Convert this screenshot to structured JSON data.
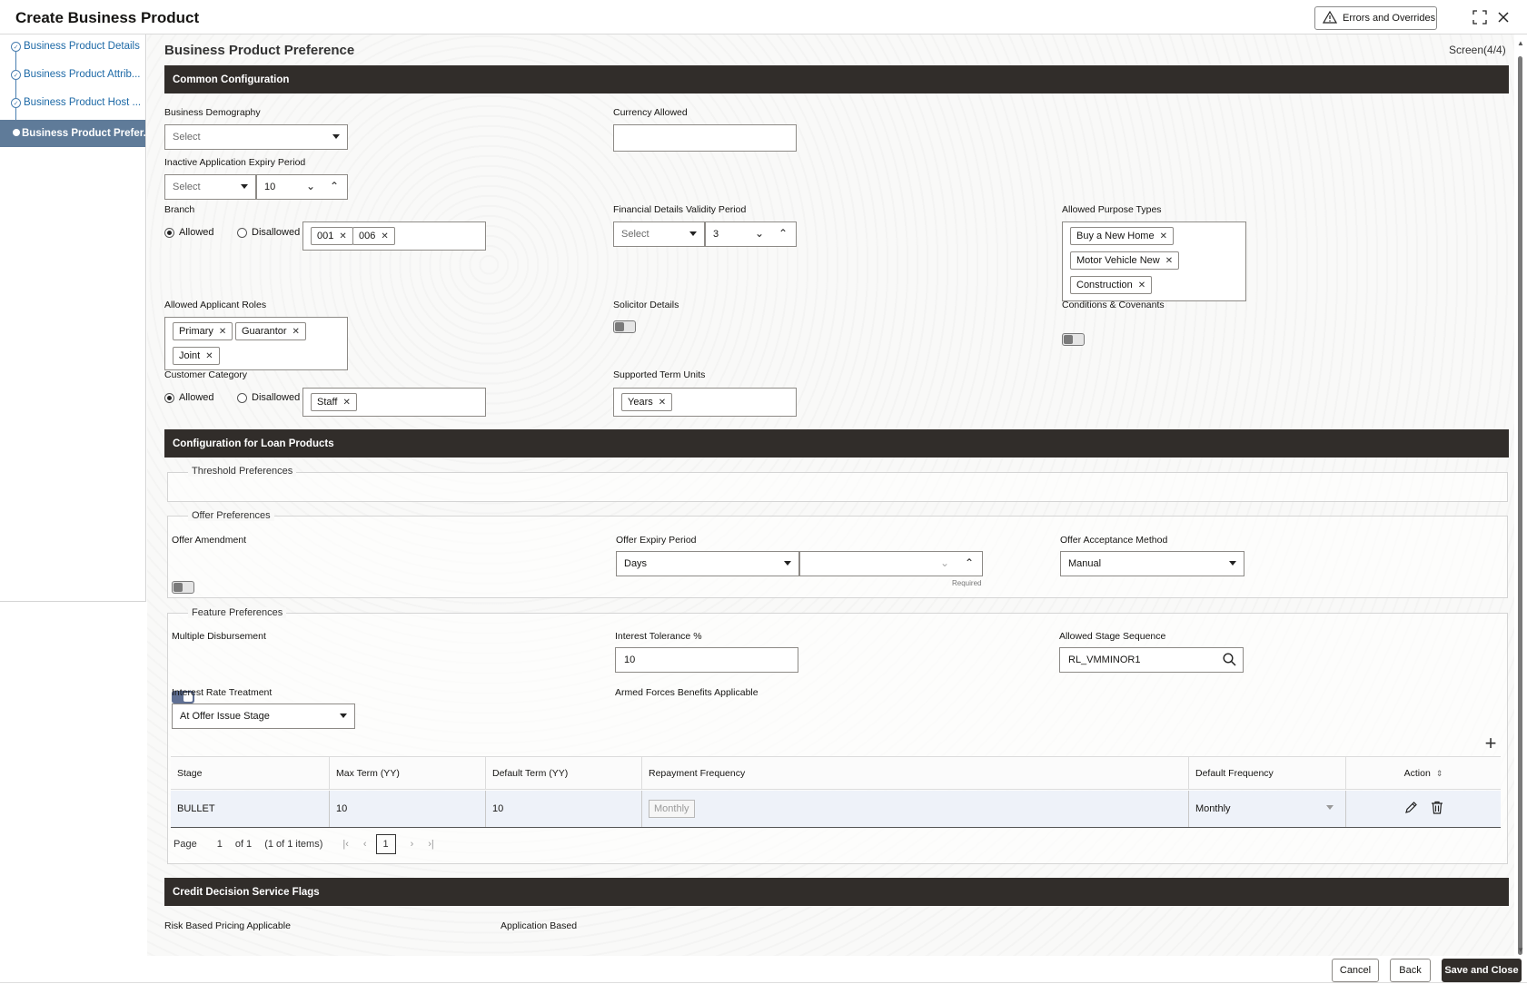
{
  "window": {
    "title": "Create Business Product",
    "errors_button": "Errors and Overrides"
  },
  "sidebar": {
    "steps": [
      {
        "label": "Business Product Details"
      },
      {
        "label": "Business Product Attrib..."
      },
      {
        "label": "Business Product Host ..."
      },
      {
        "label": "Business Product Prefer..."
      }
    ]
  },
  "page": {
    "title": "Business Product Preference",
    "screen": "Screen(4/4)"
  },
  "common": {
    "section_title": "Common Configuration",
    "business_demography": {
      "label": "Business Demography",
      "value": "Select"
    },
    "currency_allowed": {
      "label": "Currency Allowed",
      "value": ""
    },
    "inactive_expiry": {
      "label": "Inactive Application Expiry Period",
      "unit": "Select",
      "value": "10"
    },
    "branch": {
      "label": "Branch",
      "allowed": "Allowed",
      "disallowed": "Disallowed",
      "chips": [
        "001",
        "006"
      ]
    },
    "financial_validity": {
      "label": "Financial Details Validity Period",
      "unit": "Select",
      "value": "3"
    },
    "purpose_types": {
      "label": "Allowed Purpose Types",
      "chips": [
        "Buy a New Home",
        "Motor Vehicle New",
        "Construction"
      ]
    },
    "applicant_roles": {
      "label": "Allowed Applicant Roles",
      "chips": [
        "Primary",
        "Guarantor",
        "Joint"
      ]
    },
    "solicitor": {
      "label": "Solicitor Details",
      "on": false
    },
    "conditions": {
      "label": "Conditions & Covenants",
      "on": false
    },
    "customer_category": {
      "label": "Customer Category",
      "allowed": "Allowed",
      "disallowed": "Disallowed",
      "chips": [
        "Staff"
      ]
    },
    "term_units": {
      "label": "Supported Term Units",
      "chips": [
        "Years"
      ]
    }
  },
  "loan": {
    "section_title": "Configuration for Loan Products",
    "threshold_legend": "Threshold Preferences",
    "offer_legend": "Offer Preferences",
    "offer_amendment": {
      "label": "Offer Amendment",
      "on": false
    },
    "offer_expiry": {
      "label": "Offer Expiry Period",
      "unit": "Days",
      "value": "",
      "hint": "Required"
    },
    "offer_acceptance": {
      "label": "Offer Acceptance Method",
      "value": "Manual"
    },
    "feature_legend": "Feature Preferences",
    "multiple_disbursement": {
      "label": "Multiple Disbursement",
      "on": true
    },
    "interest_tolerance": {
      "label": "Interest Tolerance %",
      "value": "10"
    },
    "stage_sequence": {
      "label": "Allowed Stage Sequence",
      "value": "RL_VMMINOR1"
    },
    "rate_treatment": {
      "label": "Interest Rate Treatment",
      "value": "At Offer Issue Stage"
    },
    "armed_forces": {
      "label": "Armed Forces Benefits Applicable",
      "on": true
    },
    "table": {
      "headers": [
        "Stage",
        "Max Term (YY)",
        "Default Term (YY)",
        "Repayment Frequency",
        "Default Frequency",
        "Action"
      ],
      "rows": [
        {
          "stage": "BULLET",
          "max_term": "10",
          "default_term": "10",
          "repayment": "Monthly",
          "default_freq": "Monthly"
        }
      ]
    },
    "pager": {
      "page_label": "Page",
      "page": "1",
      "of": "of 1",
      "items": "(1 of 1 items)",
      "current": "1"
    }
  },
  "credit": {
    "section_title": "Credit Decision Service Flags",
    "risk_pricing": {
      "label": "Risk Based Pricing Applicable",
      "on": false
    },
    "application_based": {
      "label": "Application Based",
      "on": false
    }
  },
  "footer": {
    "cancel": "Cancel",
    "back": "Back",
    "save": "Save and Close"
  }
}
